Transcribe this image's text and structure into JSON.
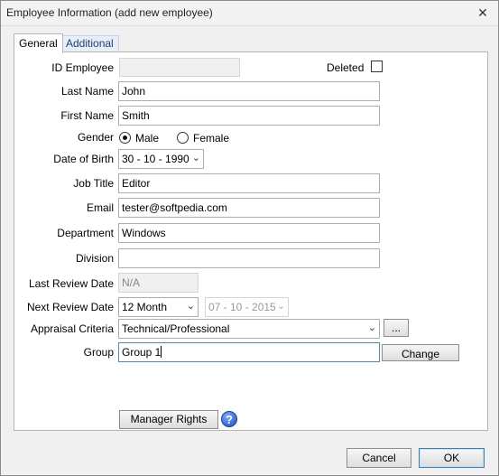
{
  "window": {
    "title": "Employee Information (add new employee)",
    "close_glyph": "✕"
  },
  "tabs": [
    {
      "label": "General",
      "active": true
    },
    {
      "label": "Additional",
      "active": false
    }
  ],
  "form": {
    "id_employee": {
      "label": "ID Employee",
      "value": ""
    },
    "deleted": {
      "label": "Deleted",
      "checked": false
    },
    "last_name": {
      "label": "Last Name",
      "value": "John"
    },
    "first_name": {
      "label": "First Name",
      "value": "Smith"
    },
    "gender": {
      "label": "Gender",
      "options": [
        {
          "label": "Male",
          "selected": true
        },
        {
          "label": "Female",
          "selected": false
        }
      ]
    },
    "date_of_birth": {
      "label": "Date of Birth",
      "value": "30 - 10 - 1990"
    },
    "job_title": {
      "label": "Job Title",
      "value": "Editor"
    },
    "email": {
      "label": "Email",
      "value": "tester@softpedia.com"
    },
    "department": {
      "label": "Department",
      "value": "Windows"
    },
    "division": {
      "label": "Division",
      "value": ""
    },
    "last_review_date": {
      "label": "Last Review Date",
      "value": "N/A"
    },
    "next_review_date": {
      "label": "Next Review Date",
      "period": "12 Month",
      "date": "07 - 10 - 2015"
    },
    "appraisal_criteria": {
      "label": "Appraisal Criteria",
      "value": "Technical/Professional",
      "more_label": "..."
    },
    "group": {
      "label": "Group",
      "value": "Group 1",
      "change_label": "Change"
    }
  },
  "manager_rights_label": "Manager Rights",
  "help_glyph": "?",
  "footer": {
    "cancel_label": "Cancel",
    "ok_label": "OK"
  }
}
